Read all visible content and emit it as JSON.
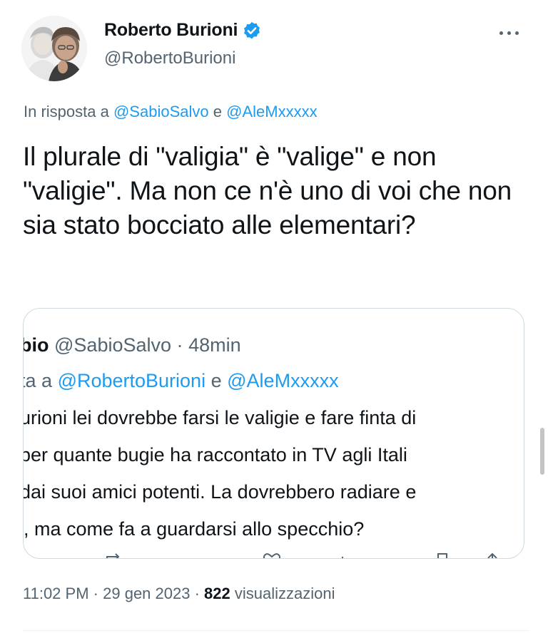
{
  "author": {
    "name": "Roberto Burioni",
    "handle": "@RobertoBurioni"
  },
  "reply_to": {
    "prefix": "In risposta a",
    "users": [
      "@SabioSalvo",
      "@AleMxxxxx"
    ],
    "joiner": "e"
  },
  "tweet_text": "Il plurale di \"valigia\" è \"valige\" e non \"valigie\". Ma non ce n'è uno di voi che non sia stato bocciato alle elementari?",
  "quoted": {
    "name": "bio",
    "handle": "@SabioSalvo",
    "separator": "·",
    "time": "48min",
    "reply_prefix": "ta a",
    "reply_users": [
      "@RobertoBurioni",
      "@AleMxxxxx"
    ],
    "reply_joiner": "e",
    "lines": [
      "urioni lei dovrebbe farsi le valigie e fare finta di",
      " per quante bugie ha raccontato in TV agli Itali",
      "dai suoi amici potenti. La dovrebbero radiare e",
      "e, ma come fa a guardarsi allo specchio?"
    ]
  },
  "meta": {
    "time": "11:02 PM",
    "separator": "·",
    "date": "29 gen 2023",
    "views_count": "822",
    "views_label": "visualizzazioni"
  },
  "colors": {
    "accent": "#1d9bf0",
    "text": "#0f1419",
    "secondary": "#536471",
    "border": "#cfd9de"
  },
  "icons": [
    "verified-badge-icon",
    "more-options-icon",
    "retweet-icon",
    "like-icon",
    "views-icon",
    "share-icon"
  ]
}
